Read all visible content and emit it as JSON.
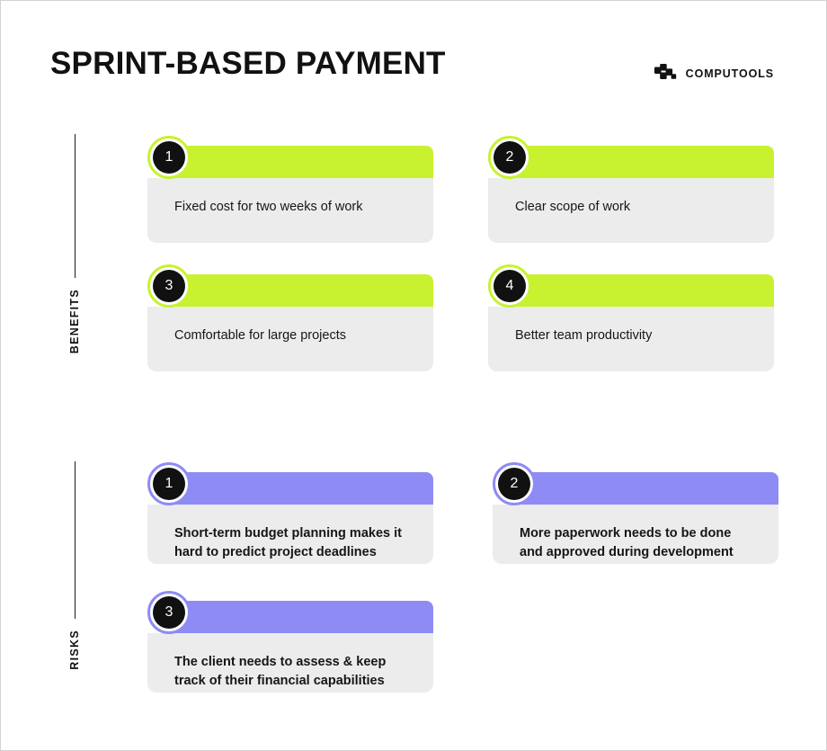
{
  "header": {
    "title": "SPRINT-BASED PAYMENT",
    "brand_name": "COMPUTOOLS",
    "brand_icon": "computools-nodes-logo-icon"
  },
  "colors": {
    "benefit_accent": "#C8F230",
    "risk_accent": "#8E8BF5",
    "card_body": "#ECECEC",
    "badge_fill": "#111111",
    "text": "#15161A",
    "page_background": "#FFFFFF",
    "frame_border": "#D2D2D2"
  },
  "sections": [
    {
      "id": "benefits",
      "label": "BENEFITS",
      "accent": "#C8F230",
      "items": [
        {
          "number": "1",
          "text": "Fixed cost for two weeks of work"
        },
        {
          "number": "2",
          "text": "Clear scope of work"
        },
        {
          "number": "3",
          "text": "Comfortable for large projects"
        },
        {
          "number": "4",
          "text": "Better team productivity"
        }
      ]
    },
    {
      "id": "risks",
      "label": "RISKS",
      "accent": "#8E8BF5",
      "items": [
        {
          "number": "1",
          "text": "Short-term budget planning makes it hard to predict project deadlines"
        },
        {
          "number": "2",
          "text": "More paperwork needs to be done and approved during development"
        },
        {
          "number": "3",
          "text": "The client needs to assess & keep track of their financial capabilities"
        }
      ]
    }
  ]
}
